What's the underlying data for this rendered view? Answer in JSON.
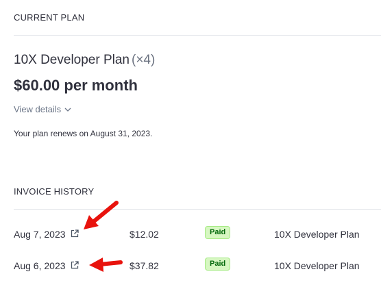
{
  "current_plan": {
    "section_title": "CURRENT PLAN",
    "plan_name": "10X Developer Plan",
    "plan_quantity": "(×4)",
    "price": "$60.00 per month",
    "view_details_label": "View details",
    "renewal_text": "Your plan renews on August 31, 2023."
  },
  "invoice_history": {
    "section_title": "INVOICE HISTORY",
    "rows": [
      {
        "date": "Aug 7, 2023",
        "amount": "$12.02",
        "status": "Paid",
        "plan": "10X Developer Plan"
      },
      {
        "date": "Aug 6, 2023",
        "amount": "$37.82",
        "status": "Paid",
        "plan": "10X Developer Plan"
      }
    ]
  },
  "colors": {
    "annotation_arrow": "#e8130d",
    "paid_badge_bg": "#d7f7c2",
    "paid_badge_text": "#05690d"
  },
  "icons": {
    "external_link": "external-link-icon",
    "chevron": "chevron-down-icon"
  }
}
